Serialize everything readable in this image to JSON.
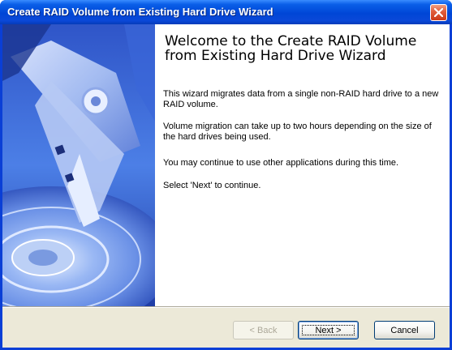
{
  "window": {
    "title": "Create RAID Volume from Existing Hard Drive Wizard"
  },
  "content": {
    "heading": "Welcome to the Create RAID Volume from Existing Hard Drive Wizard",
    "paragraphs": [
      "This wizard migrates data from a single non-RAID hard drive to a new RAID volume.",
      "Volume migration can take up to two hours depending on the size of the hard drives being used.",
      "You may continue to use other applications during this time.",
      "Select 'Next' to continue."
    ]
  },
  "buttons": {
    "back": "< Back",
    "next": "Next >",
    "cancel": "Cancel"
  },
  "colors": {
    "titlebar": "#0a48d8",
    "dialog_background": "#ece9d8",
    "side_image": "#3a6ee0"
  },
  "icons": {
    "close": "close-icon",
    "side_image": "hard-drive-illustration"
  }
}
